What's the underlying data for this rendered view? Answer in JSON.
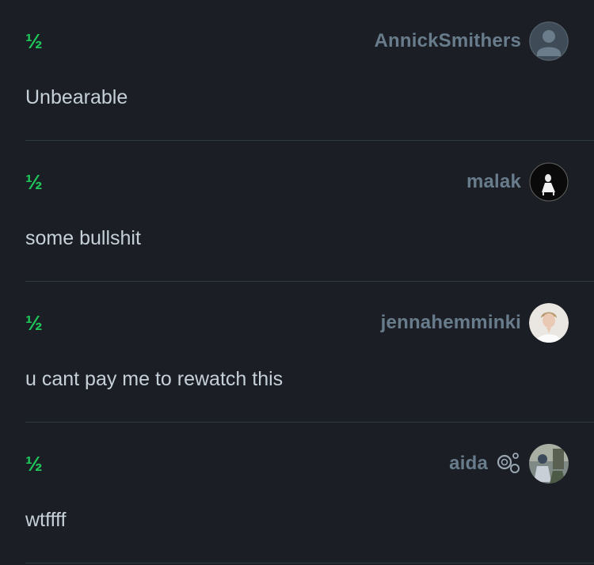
{
  "reviews": [
    {
      "rating": "½",
      "username": "AnnickSmithers",
      "text": "Unbearable",
      "avatar": "default-avatar-icon"
    },
    {
      "rating": "½",
      "username": "malak",
      "text": "some bullshit",
      "avatar": "photo"
    },
    {
      "rating": "½",
      "username": "jennahemminki",
      "text": "u cant pay me to rewatch this",
      "avatar": "photo"
    },
    {
      "rating": "½",
      "username": "aida",
      "text": "wtffff",
      "avatar": "photo",
      "badge": "patron-circles-icon"
    }
  ],
  "colors": {
    "background": "#1b1f25",
    "rating": "#1fc65a",
    "username": "#687c8c",
    "text": "#c6d0d8",
    "divider": "#2f3a44"
  }
}
